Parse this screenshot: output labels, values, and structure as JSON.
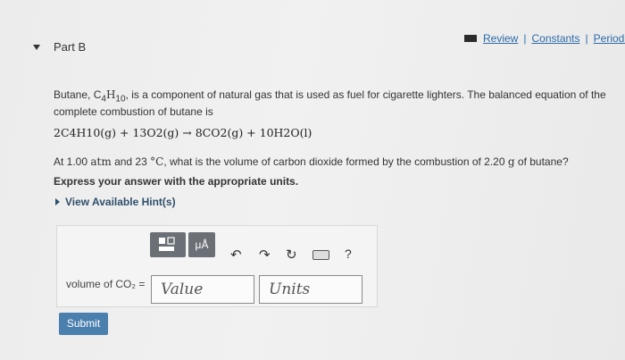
{
  "header": {
    "links": [
      "Review",
      "Constants",
      "Periodic Ta"
    ]
  },
  "part": {
    "title": "Part B"
  },
  "question": {
    "text_line1": "Butane, C",
    "formula_sub_4": "4",
    "formula_H": "H",
    "formula_sub_10": "10",
    "text_rest": ", is a component of natural gas that is used as fuel for cigarette lighters. The balanced equation of the complete combustion of butane is",
    "equation": "2C4H10(g) + 13O2(g) → 8CO2(g) + 10H2O(l)",
    "conditions_prefix": "At 1.00",
    "pressure_unit": "atm",
    "conditions_and": "and 23",
    "temp_unit": "°C",
    "conditions_middle": ", what is the volume of carbon dioxide formed by the combustion of 2.20",
    "mass_unit": "g",
    "conditions_suffix": "of butane?",
    "instruction": "Express your answer with the appropriate units.",
    "hints": "View Available Hint(s)"
  },
  "answer": {
    "label": "volume of CO₂ =",
    "value_placeholder": "Value",
    "units_placeholder": "Units",
    "submit": "Submit"
  },
  "toolbar": {
    "units_btn_label": "μÅ",
    "help": "?"
  },
  "colors": {
    "link": "#2b6aa8",
    "submit": "#4b7fad",
    "toolbar_button": "#6b6f76"
  }
}
